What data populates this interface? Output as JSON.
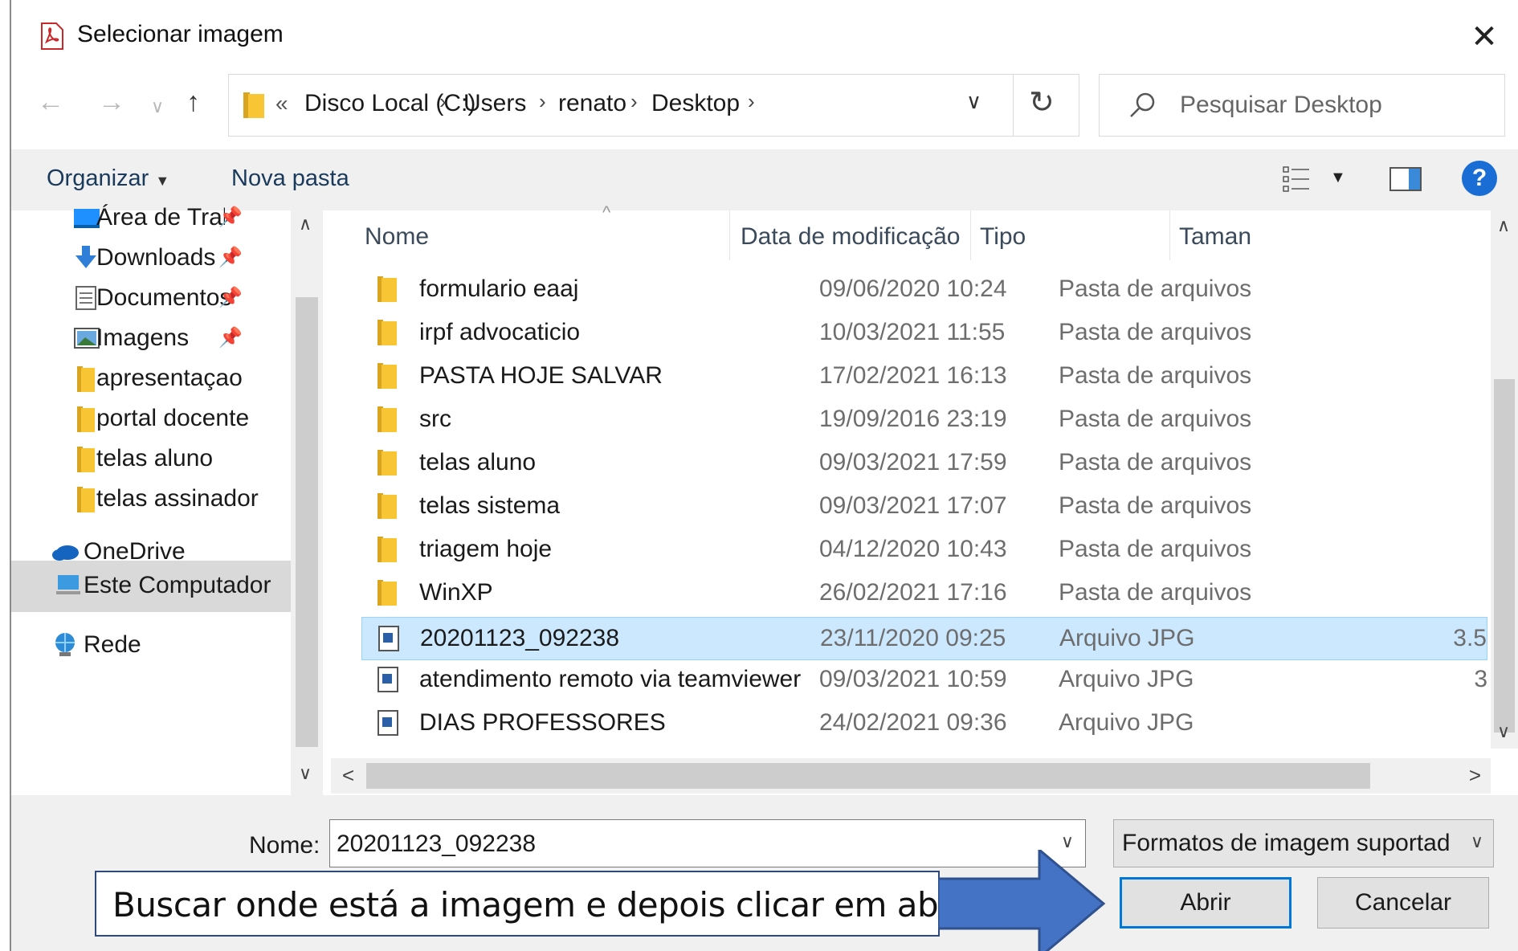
{
  "title": "Selecionar imagem",
  "address": {
    "overflow": "«",
    "crumbs": [
      "Disco Local (C:)",
      "Users",
      "renato",
      "Desktop"
    ]
  },
  "search": {
    "placeholder": "Pesquisar Desktop"
  },
  "toolbar": {
    "organize_label": "Organizar",
    "new_folder_label": "Nova pasta",
    "help_label": "?"
  },
  "nav": {
    "quick_access": [
      {
        "label": "Área de Traba",
        "pinned": true,
        "icon": "desktop-icon"
      },
      {
        "label": "Downloads",
        "pinned": true,
        "icon": "download-icon"
      },
      {
        "label": "Documentos",
        "pinned": true,
        "icon": "documents-icon"
      },
      {
        "label": "Imagens",
        "pinned": true,
        "icon": "pictures-icon"
      },
      {
        "label": "apresentaçao as:",
        "pinned": false,
        "icon": "folder-icon"
      },
      {
        "label": "portal docente",
        "pinned": false,
        "icon": "folder-icon"
      },
      {
        "label": "telas aluno",
        "pinned": false,
        "icon": "folder-icon"
      },
      {
        "label": "telas assinador",
        "pinned": false,
        "icon": "folder-icon"
      }
    ],
    "onedrive": "OneDrive",
    "this_pc": "Este Computador",
    "network": "Rede"
  },
  "columns": {
    "name": "Nome",
    "date": "Data de modificação",
    "type": "Tipo",
    "size": "Taman"
  },
  "files": [
    {
      "name": "formulario eaaj",
      "date": "09/06/2020 10:24",
      "type": "Pasta de arquivos",
      "size": "",
      "kind": "folder"
    },
    {
      "name": "irpf advocaticio",
      "date": "10/03/2021 11:55",
      "type": "Pasta de arquivos",
      "size": "",
      "kind": "folder"
    },
    {
      "name": "PASTA HOJE SALVAR",
      "date": "17/02/2021 16:13",
      "type": "Pasta de arquivos",
      "size": "",
      "kind": "folder"
    },
    {
      "name": "src",
      "date": "19/09/2016 23:19",
      "type": "Pasta de arquivos",
      "size": "",
      "kind": "folder"
    },
    {
      "name": "telas aluno",
      "date": "09/03/2021 17:59",
      "type": "Pasta de arquivos",
      "size": "",
      "kind": "folder"
    },
    {
      "name": "telas sistema",
      "date": "09/03/2021 17:07",
      "type": "Pasta de arquivos",
      "size": "",
      "kind": "folder"
    },
    {
      "name": "triagem hoje",
      "date": "04/12/2020 10:43",
      "type": "Pasta de arquivos",
      "size": "",
      "kind": "folder"
    },
    {
      "name": "WinXP",
      "date": "26/02/2021 17:16",
      "type": "Pasta de arquivos",
      "size": "",
      "kind": "folder"
    },
    {
      "name": "20201123_092238",
      "date": "23/11/2020 09:25",
      "type": "Arquivo JPG",
      "size": "3.5",
      "kind": "image",
      "selected": true
    },
    {
      "name": "atendimento remoto via teamviewer",
      "date": "09/03/2021 10:59",
      "type": "Arquivo JPG",
      "size": "3",
      "kind": "image"
    },
    {
      "name": "DIAS PROFESSORES",
      "date": "24/02/2021 09:36",
      "type": "Arquivo JPG",
      "size": "",
      "kind": "image"
    }
  ],
  "footer": {
    "name_label": "Nome:",
    "name_value": "20201123_092238",
    "filetype_value": "Formatos de imagem suportad",
    "open_label": "Abrir",
    "cancel_label": "Cancelar"
  },
  "annotation": {
    "text": "Buscar onde está a imagem e depois clicar em abrir."
  },
  "colors": {
    "accent": "#0078d7",
    "selection": "#cce8ff",
    "folder": "#f8c534",
    "callout_arrow": "#4472c4"
  }
}
